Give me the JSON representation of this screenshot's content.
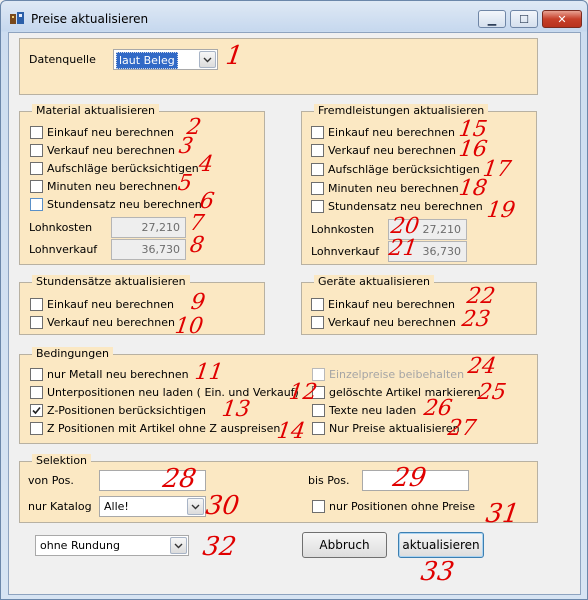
{
  "window": {
    "title": "Preise aktualisieren"
  },
  "datenquelle": {
    "label": "Datenquelle",
    "value": "laut Beleg"
  },
  "material": {
    "title": "Material aktualisieren",
    "items": [
      {
        "label": "Einkauf neu berechnen",
        "checked": false
      },
      {
        "label": "Verkauf  neu berechnen",
        "checked": false
      },
      {
        "label": "Aufschläge berücksichtigen",
        "checked": false
      },
      {
        "label": "Minuten neu berechnen",
        "checked": false
      },
      {
        "label": "Stundensatz neu berechnen",
        "checked": false
      }
    ],
    "lohnkosten_label": "Lohnkosten",
    "lohnkosten_value": "27,210",
    "lohnverkauf_label": "Lohnverkauf",
    "lohnverkauf_value": "36,730"
  },
  "fremd": {
    "title": "Fremdleistungen aktualisieren",
    "items": [
      {
        "label": "Einkauf neu berechnen",
        "checked": false
      },
      {
        "label": "Verkauf  neu berechnen",
        "checked": false
      },
      {
        "label": "Aufschläge berücksichtigen",
        "checked": false
      },
      {
        "label": "Minuten neu berechnen",
        "checked": false
      },
      {
        "label": "Stundensatz neu berechnen",
        "checked": false
      }
    ],
    "lohnkosten_label": "Lohnkosten",
    "lohnkosten_value": "27,210",
    "lohnverkauf_label": "Lohnverkauf",
    "lohnverkauf_value": "36,730"
  },
  "stunden": {
    "title": "Stundensätze aktualisieren",
    "items": [
      {
        "label": "Einkauf neu berechnen",
        "checked": false
      },
      {
        "label": "Verkauf  neu berechnen",
        "checked": false
      }
    ]
  },
  "geraete": {
    "title": "Geräte aktualisieren",
    "items": [
      {
        "label": "Einkauf neu berechnen",
        "checked": false
      },
      {
        "label": "Verkauf  neu berechnen",
        "checked": false
      }
    ]
  },
  "bedingungen": {
    "title": "Bedingungen",
    "left": [
      {
        "label": "nur Metall neu berechnen",
        "checked": false
      },
      {
        "label": "Unterpositionen neu laden ( Ein. und Verkauf)",
        "checked": false
      },
      {
        "label": "Z-Positionen berücksichtigen",
        "checked": true
      },
      {
        "label": "Z  Positionen mit Artikel ohne Z auspreisen",
        "checked": false
      }
    ],
    "right": [
      {
        "label": "Einzelpreise beibehalten",
        "checked": false,
        "disabled": true
      },
      {
        "label": "gelöschte Artikel markieren",
        "checked": false
      },
      {
        "label": "Texte neu laden",
        "checked": false
      },
      {
        "label": "Nur Preise aktualisieren",
        "checked": false
      }
    ]
  },
  "selektion": {
    "title": "Selektion",
    "von_label": "von Pos.",
    "von_value": "",
    "bis_label": "bis Pos.",
    "bis_value": "",
    "katalog_label": "nur Katalog",
    "katalog_value": "Alle!",
    "ohne_preise_label": "nur Positionen ohne Preise",
    "ohne_preise_checked": false
  },
  "rundung": {
    "value": "ohne Rundung"
  },
  "buttons": {
    "abbruch": "Abbruch",
    "aktualisieren": "aktualisieren"
  },
  "annotations": [
    "1",
    "2",
    "3",
    "4",
    "5",
    "6",
    "7",
    "8",
    "9",
    "10",
    "11",
    "12",
    "13",
    "14",
    "15",
    "16",
    "17",
    "18",
    "19",
    "20",
    "21",
    "22",
    "23",
    "24",
    "25",
    "26",
    "27",
    "28",
    "29",
    "30",
    "31",
    "32",
    "33"
  ],
  "colors": {
    "panel": "#fbe8c3",
    "annotation": "#e00000",
    "selection": "#3169c6"
  }
}
